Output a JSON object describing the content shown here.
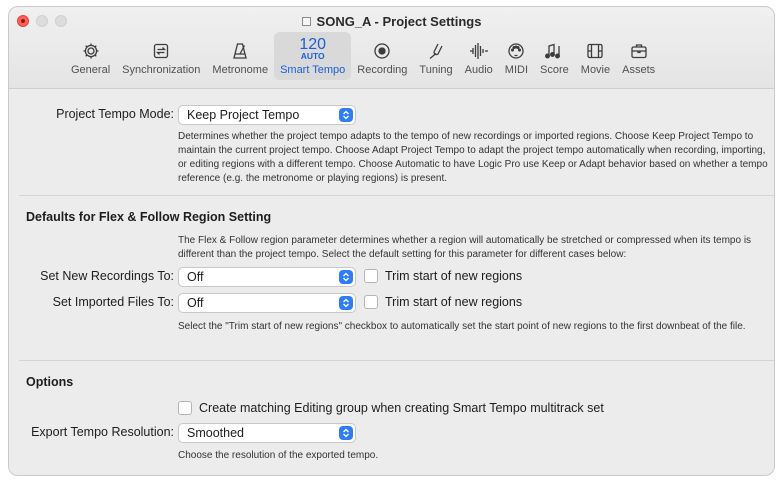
{
  "window": {
    "title": "SONG_A - Project Settings"
  },
  "toolbar": {
    "items": [
      {
        "label": "General",
        "icon": "gear-icon"
      },
      {
        "label": "Synchronization",
        "icon": "sync-icon"
      },
      {
        "label": "Metronome",
        "icon": "metronome-icon"
      },
      {
        "label": "Smart Tempo",
        "icon": "smart-tempo-icon",
        "value": "120",
        "badge": "AUTO"
      },
      {
        "label": "Recording",
        "icon": "record-icon"
      },
      {
        "label": "Tuning",
        "icon": "tuning-fork-icon"
      },
      {
        "label": "Audio",
        "icon": "waveform-icon"
      },
      {
        "label": "MIDI",
        "icon": "midi-icon"
      },
      {
        "label": "Score",
        "icon": "notes-icon"
      },
      {
        "label": "Movie",
        "icon": "film-icon"
      },
      {
        "label": "Assets",
        "icon": "briefcase-icon"
      }
    ]
  },
  "tempo": {
    "label": "Project Tempo Mode:",
    "value": "Keep Project Tempo",
    "description": "Determines whether the project tempo adapts to the tempo of new recordings or imported regions. Choose Keep Project Tempo to maintain the current project tempo. Choose Adapt Project Tempo to adapt the project tempo automatically when recording, importing, or editing regions with a different tempo. Choose Automatic to  have Logic Pro use Keep or Adapt behavior based on whether a tempo reference (e.g. the metronome or playing regions) is present."
  },
  "flex": {
    "heading": "Defaults for Flex & Follow Region Setting",
    "description": "The Flex & Follow region parameter determines whether a region will automatically be stretched or compressed when its tempo is different than the project tempo. Select the default setting for this parameter for different cases below:",
    "new_recordings": {
      "label": "Set New Recordings To:",
      "value": "Off",
      "checkbox": "Trim start of new regions"
    },
    "imported_files": {
      "label": "Set Imported Files To:",
      "value": "Off",
      "checkbox": "Trim start of new regions"
    },
    "note": "Select the \"Trim start of new regions\" checkbox to automatically set the start point of new regions to the first downbeat of the file."
  },
  "options": {
    "heading": "Options",
    "checkbox": "Create matching Editing group when creating Smart Tempo multitrack set",
    "export": {
      "label": "Export Tempo Resolution:",
      "value": "Smoothed",
      "description": "Choose the resolution of the exported tempo."
    }
  },
  "colors": {
    "accent": "#2f7df6",
    "active_text": "#1a5fd6",
    "close": "#ff5f57",
    "background": "#ececec"
  }
}
